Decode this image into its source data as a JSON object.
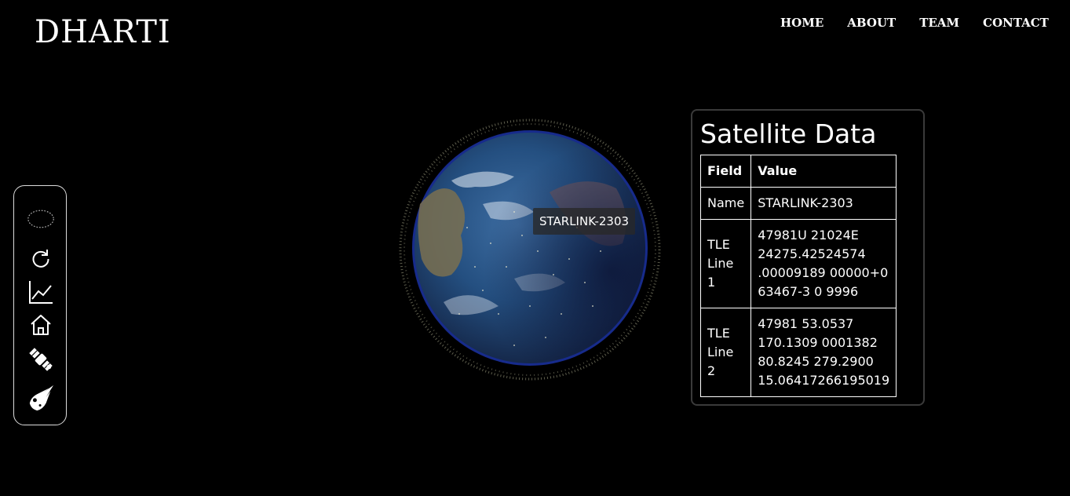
{
  "header": {
    "logo": "DHARTI",
    "nav": [
      "HOME",
      "ABOUT",
      "TEAM",
      "CONTACT"
    ]
  },
  "toolbar": {
    "tools": [
      "orbit-icon",
      "refresh-icon",
      "chart-icon",
      "home-icon",
      "satellite-icon",
      "comet-icon"
    ]
  },
  "globe": {
    "tooltip": "STARLINK-2303"
  },
  "panel": {
    "title": "Satellite Data",
    "headers": [
      "Field",
      "Value"
    ],
    "rows": [
      {
        "field": "Name",
        "value": "STARLINK-2303"
      },
      {
        "field": "TLE Line 1",
        "value": "47981U 21024E\n24275.42524574\n.00009189 00000+0\n63467-3 0 9996"
      },
      {
        "field": "TLE Line 2",
        "value": "47981 53.0537\n170.1309 0001382\n80.8245 279.2900\n15.06417266195019"
      }
    ]
  },
  "colors": {
    "background": "#000000",
    "ocean": "#1f4f86",
    "atmosphere": "#2a4fff"
  }
}
